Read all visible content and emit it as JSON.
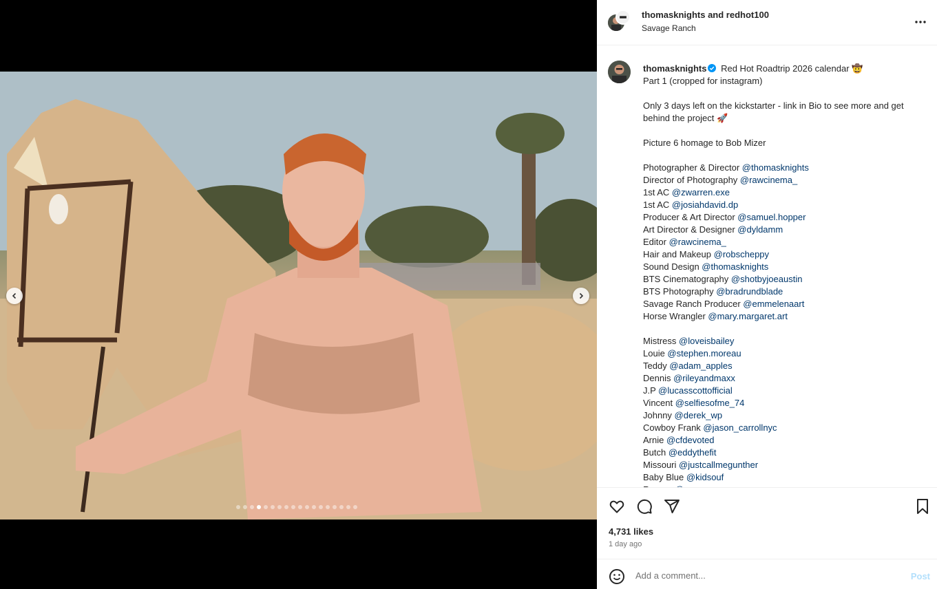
{
  "header": {
    "names": "thomasknights and redhot100",
    "location": "Savage Ranch"
  },
  "carousel": {
    "total_slides": 18,
    "active_slide": 4
  },
  "caption": {
    "username": "thomasknights",
    "lines": [
      {
        "text": "Red Hot Roadtrip 2026 calendar 🤠",
        "mention": ""
      },
      {
        "text": "Part 1 (cropped for instagram)",
        "mention": ""
      },
      {
        "text": "",
        "mention": ""
      },
      {
        "text": "Only 3 days left on the kickstarter - link in Bio to see more and get behind the project 🚀",
        "mention": ""
      },
      {
        "text": "",
        "mention": ""
      },
      {
        "text": "Picture 6 homage to Bob Mizer",
        "mention": ""
      },
      {
        "text": "",
        "mention": ""
      },
      {
        "text": "Photographer & Director ",
        "mention": "@thomasknights"
      },
      {
        "text": "Director of Photography ",
        "mention": "@rawcinema_"
      },
      {
        "text": "1st AC ",
        "mention": "@zwarren.exe"
      },
      {
        "text": "1st AC ",
        "mention": "@josiahdavid.dp"
      },
      {
        "text": "Producer & Art Director ",
        "mention": "@samuel.hopper"
      },
      {
        "text": "Art Director & Designer ",
        "mention": "@dyldamm"
      },
      {
        "text": "Editor ",
        "mention": "@rawcinema_"
      },
      {
        "text": "Hair and Makeup ",
        "mention": "@robscheppy"
      },
      {
        "text": "Sound Design ",
        "mention": "@thomasknights"
      },
      {
        "text": "BTS Cinematography ",
        "mention": "@shotbyjoeaustin"
      },
      {
        "text": "BTS Photography ",
        "mention": "@bradrundblade"
      },
      {
        "text": "Savage Ranch Producer ",
        "mention": "@emmelenaart"
      },
      {
        "text": "Horse Wrangler ",
        "mention": "@mary.margaret.art"
      },
      {
        "text": "",
        "mention": ""
      },
      {
        "text": "Mistress ",
        "mention": "@loveisbailey"
      },
      {
        "text": "Louie ",
        "mention": "@stephen.moreau"
      },
      {
        "text": "Teddy ",
        "mention": "@adam_apples"
      },
      {
        "text": "Dennis ",
        "mention": "@rileyandmaxx"
      },
      {
        "text": "J.P ",
        "mention": "@lucasscottofficial"
      },
      {
        "text": "Vincent ",
        "mention": "@selfiesofme_74"
      },
      {
        "text": "Johnny ",
        "mention": "@derek_wp"
      },
      {
        "text": "Cowboy Frank ",
        "mention": "@jason_carrollnyc"
      },
      {
        "text": "Arnie ",
        "mention": "@cfdevoted"
      },
      {
        "text": "Butch ",
        "mention": "@eddythefit"
      },
      {
        "text": "Missouri ",
        "mention": "@justcallmegunther"
      },
      {
        "text": "Baby Blue ",
        "mention": "@kidsouf"
      },
      {
        "text": "Ranger ",
        "mention": "@"
      }
    ]
  },
  "stats": {
    "likes": "4,731 likes",
    "time": "1 day ago"
  },
  "comment": {
    "placeholder": "Add a comment...",
    "post_label": "Post"
  },
  "icons": {
    "more": "more-options-icon",
    "verified": "verified-badge-icon",
    "like": "heart-icon",
    "comment": "comment-icon",
    "share": "share-icon",
    "save": "bookmark-icon",
    "emoji": "emoji-icon",
    "prev": "chevron-left-icon",
    "next": "chevron-right-icon"
  },
  "colors": {
    "mention": "#00376b",
    "verified": "#0095f6",
    "post_disabled": "#b2dffc"
  }
}
